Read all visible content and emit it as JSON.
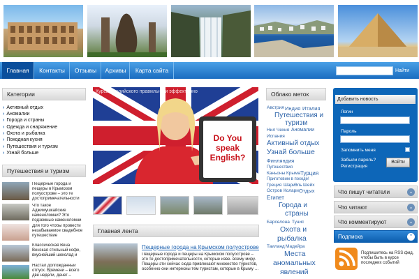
{
  "nav": {
    "items": [
      "Главная",
      "Контакты",
      "Отзывы",
      "Архивы",
      "Карта сайта"
    ],
    "search_button": "Найти"
  },
  "left": {
    "categories_title": "Категории",
    "categories": [
      "Активный отдых",
      "Аномалии",
      "Города и страны",
      "Одежда и снаряжение",
      "Охота и рыбалка",
      "Походная кухня",
      "Путешествия и туризм",
      "Узнай больше"
    ],
    "travel_title": "Путешествия и туризм",
    "posts": [
      "Пещерные города и пещеры в Крымском полуострове – это те достопримечательности",
      "Что такое Аджимушкайские каменоломни? Это подземные каменоломни",
      "Для того чтобы провести незабываемое свадебное путешествие",
      "Классическая Вена Венская стильный кофе, вкуснейший шоколад и",
      "Настал долгожданный отпуск. Времени – всего две недели, денег –"
    ]
  },
  "center": {
    "slider_caption": "Курсы английского правильно и эффективно",
    "sign_text": "Do You speak English?",
    "feed_title": "Главная лента",
    "post_title": "Пещерные города на Крымском полуострове…",
    "post_excerpt": "Пещерные города и пещеры на Крымском полуострове – это те достопримечательности, которые изве- всему миру. Пещеры эти сейчас сюда привлекают множество туристов, особенно они интересны тем туристам, которые в Крыму …"
  },
  "tags": {
    "title": "Облако меток",
    "items": [
      "Австрия",
      "Индия",
      "Италия",
      "Путешествия и",
      "туризм",
      "Нил",
      "Чехия",
      "Аномалии",
      "Испания",
      "Активный отдых",
      "Узнай больше",
      "Финляндия",
      "Путешествия",
      "Каньоны",
      "Крыма",
      "Турция",
      "Приготовим в походе!",
      "Греция",
      "Шари",
      "Эль",
      "Шейх",
      "Остров",
      "Колари",
      "Отдых",
      "Египет",
      "Города и",
      "страны",
      "Барселона",
      "Тунис",
      "Охота и",
      "рыбалка",
      "Таиланд",
      "Мадейра",
      "Места",
      "аномальных",
      "явлений"
    ]
  },
  "right": {
    "add_news": "Добавить новость",
    "login_label": "Логин",
    "password_label": "Пароль",
    "remember_label": "Запомнить меня",
    "forgot_label": "Забыли пароль?",
    "register_label": "Регистрация",
    "login_button": "Войти",
    "readers_write": "Что пишут читатели",
    "reading": "Что читают",
    "commenting": "Что комментируют",
    "subscribe": "Подписка",
    "rss_text": "Подпишитесь на RSS фид, чтобы быть в курсе последних событий"
  },
  "colors": {
    "accent": "#1a6cc0",
    "sidebar_blue": "#0d66b8"
  }
}
